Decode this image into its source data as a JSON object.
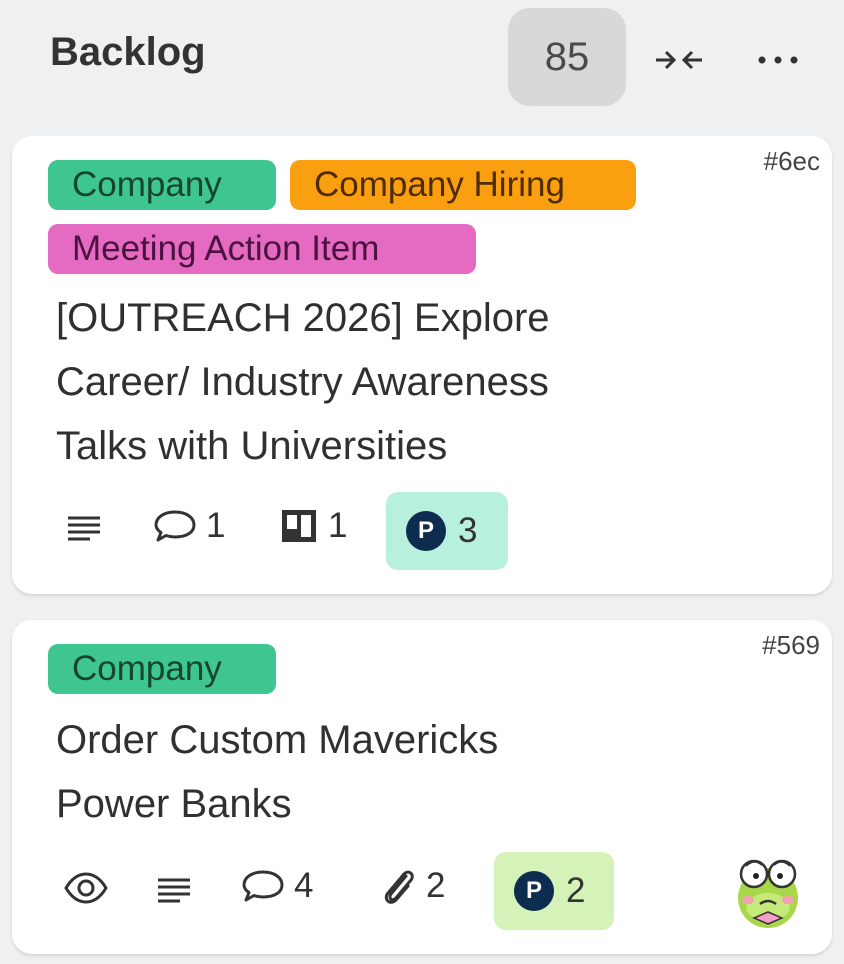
{
  "column": {
    "title": "Backlog",
    "count": "85"
  },
  "cards": [
    {
      "id": "#6ec",
      "tags": [
        "Company",
        "Company Hiring",
        "Meeting Action Item"
      ],
      "title_lines": [
        "[OUTREACH 2026] Explore",
        "Career/ Industry Awareness",
        "Talks with Universities"
      ],
      "comments": "1",
      "checklists": "1",
      "points": "3"
    },
    {
      "id": "#569",
      "tags": [
        "Company"
      ],
      "title_lines": [
        "Order Custom Mavericks",
        "Power Banks"
      ],
      "comments": "4",
      "attachments": "2",
      "points": "2"
    }
  ],
  "colors": {
    "tag_company": "#3fc58f",
    "tag_hiring": "#fa9f0f",
    "tag_meeting": "#e56bc2",
    "points_chip_1": "#b8f0de",
    "points_chip_2": "#d5f3b8",
    "points_coin": "#0d2c4f"
  },
  "icons": {
    "description": "description-icon",
    "comment": "comment-icon",
    "checklist": "checklist-icon",
    "attachment": "paperclip-icon",
    "watch": "eye-icon",
    "collapse": "collapse-icon",
    "more": "more-icon",
    "points": "points-coin-icon",
    "avatar": "frog-avatar"
  },
  "points_glyph": "P"
}
